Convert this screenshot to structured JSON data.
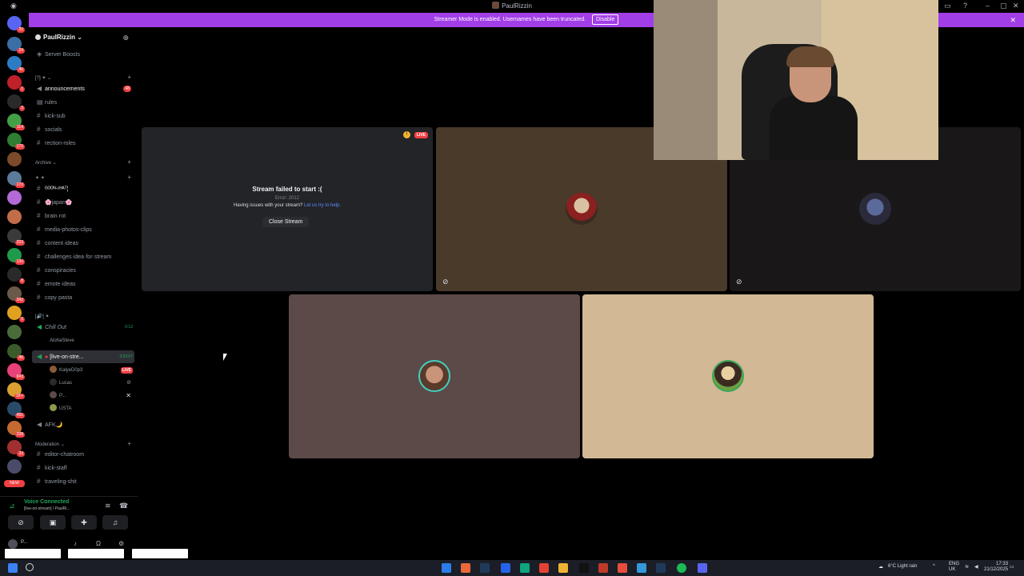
{
  "window": {
    "title": "PaulRizzin"
  },
  "banner": {
    "text": "Streamer Mode is enabled. Usernames have been truncated.",
    "disable_label": "Disable"
  },
  "rail": {
    "badges": [
      "20",
      "24",
      "46",
      "1",
      "3",
      "114",
      "176",
      "170",
      "333",
      "130",
      "8",
      "342",
      "5",
      "46",
      "843",
      "1K+",
      "491",
      "338",
      "33"
    ],
    "new_label": "NEW"
  },
  "guild": {
    "name": "PaulRizzin"
  },
  "sidebar": {
    "server_boosts": "Server Boosts",
    "category_1": "[?] ✦",
    "announcements": "announcements",
    "announcements_badge": "48",
    "rules": "rules",
    "kick_sub": "kick-sub",
    "socials": "socials",
    "rection_roles": "rection-roles",
    "category_archive": "Archive",
    "category_2": "✦ ✦",
    "goon_chat": "ᴳᴼᴼᴺ-ᶜᴴᴬᵀ¦",
    "japan": "🌸japan🌸",
    "brain_rot": "brain·rot",
    "media": "media-photos-clips",
    "content_ideas": "content·ideas",
    "challenges": "challenges·idea·for·stream",
    "conspiracies": "conspiracies",
    "emote_ideas": "emote·ideas",
    "copy_pasta": "copy·pasta",
    "category_voice": "[🔊] ✦",
    "chill_out": "Chill Out",
    "chill_out_time": "0:12",
    "voice_user_aloha": "AlohaSteve",
    "live_stream": "[live-on-stre...",
    "live_stream_time": "3:53:07",
    "voice_user_kalye": "KalyeD0p3",
    "live_label": "LIVE",
    "voice_user_lucas": "Lucas",
    "voice_user_p": "P...",
    "voice_user_usta": "USTA",
    "afk": "AFK🌙",
    "category_moderation": "Moderation",
    "editor_chatroom": "editor-chatroom",
    "kick_staff": "kick-staff",
    "traveling": "traveling-shit"
  },
  "voice_panel": {
    "status": "Voice Connected",
    "channel": "[live-on-stream] / PaulRi..."
  },
  "user_panel": {
    "name": "P..."
  },
  "stage": {
    "fail_title": "Stream failed to start :(",
    "fail_error": "Error: 2012",
    "fail_help": "Having issues with your stream?",
    "fail_help_link": "Let us try to help.",
    "close_stream": "Close Stream",
    "live_badge": "LIVE"
  },
  "taskbar": {
    "weather": "6°C  Light rain",
    "lang": "ENG",
    "region": "UK",
    "time": "17:33",
    "date": "21/12/2025"
  },
  "colors": {
    "banner": "#a23ee7",
    "tile_fail": "#232428",
    "tile_brown": "#4a3a2a",
    "tile_dark": "#1a1718",
    "tile_mauve": "#5c4a48",
    "tile_tan": "#d2b895",
    "live_red": "#f23f43",
    "voice_green": "#23a55a"
  }
}
